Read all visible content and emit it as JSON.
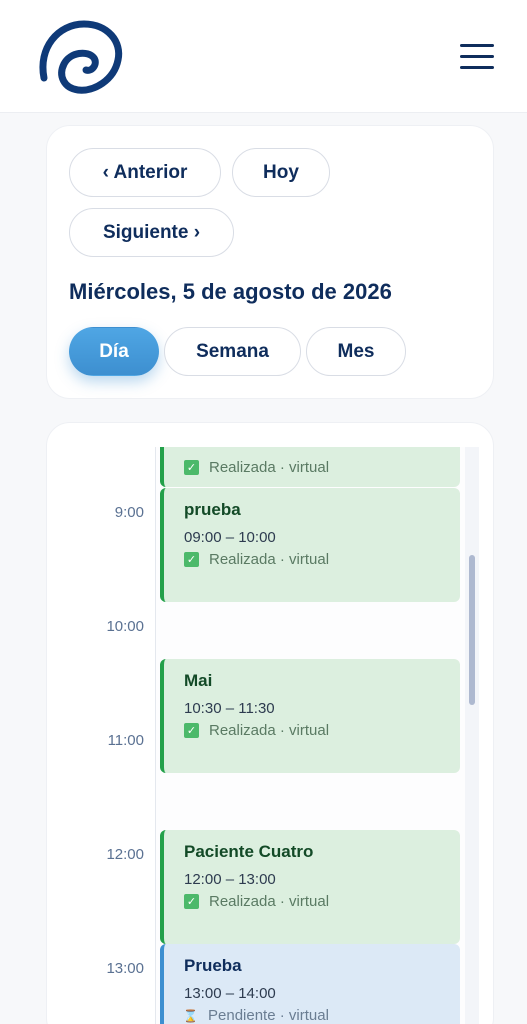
{
  "header": {
    "logo_icon": "spiral-logo-icon",
    "menu_icon": "hamburger-menu-icon"
  },
  "toolbar": {
    "prev_label": "‹ Anterior",
    "today_label": "Hoy",
    "next_label": "Siguiente ›",
    "date_title": "Miércoles, 5 de agosto de 2026",
    "views": [
      "Día",
      "Semana",
      "Mes"
    ],
    "active_view": "Día"
  },
  "calendar": {
    "hours": [
      "9:00",
      "10:00",
      "11:00",
      "12:00",
      "13:00"
    ],
    "events": [
      {
        "title": "",
        "time": "",
        "status": "Realizada · virtual",
        "state": "done"
      },
      {
        "title": "prueba",
        "time": "09:00 – 10:00",
        "status": "Realizada · virtual",
        "state": "done"
      },
      {
        "title": "Mai",
        "time": "10:30 – 11:30",
        "status": "Realizada · virtual",
        "state": "done"
      },
      {
        "title": "Paciente Cuatro",
        "time": "12:00 – 13:00",
        "status": "Realizada · virtual",
        "state": "done"
      },
      {
        "title": "Prueba",
        "time": "13:00 – 14:00",
        "status": "Pendiente · virtual",
        "state": "pending"
      }
    ]
  },
  "colors": {
    "brand": "#0f2d5c",
    "accent": "#3d8fd0",
    "done_bg": "#dcefdf",
    "done_border": "#23a04a",
    "pending_bg": "#dce9f6"
  }
}
